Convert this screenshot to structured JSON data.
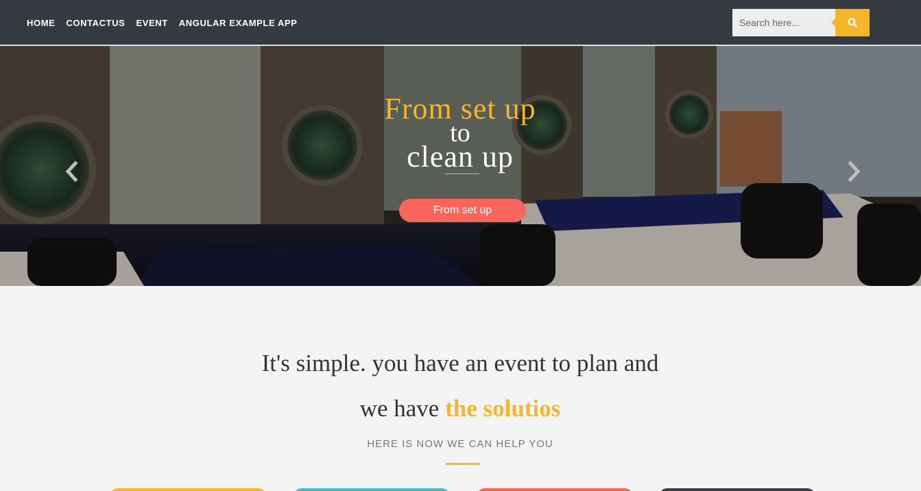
{
  "nav": {
    "items": [
      {
        "label": "HOME"
      },
      {
        "label": "CONTACTUS"
      },
      {
        "label": "EVENT"
      },
      {
        "label": "ANGULAR EXAMPLE APP"
      }
    ],
    "search": {
      "placeholder": "Search here...",
      "icon": "search-icon"
    }
  },
  "hero": {
    "line1": "From set up",
    "line2": "to",
    "line3": "clean up",
    "cta_label": "From set up",
    "prev_icon": "chevron-left-icon",
    "next_icon": "chevron-right-icon"
  },
  "intro": {
    "line1": "It's simple. you have an event to plan and",
    "line2_prefix": "we have ",
    "line2_highlight": "the solutios",
    "subtitle": "HERE IS NOW WE CAN HELP YOU"
  },
  "colors": {
    "navbar": "#343a40",
    "accent": "#f7b52c",
    "cta": "#f9655b",
    "teal": "#4fb6c4",
    "dark": "#3a3f46",
    "page_bg": "#f4f4f4"
  }
}
